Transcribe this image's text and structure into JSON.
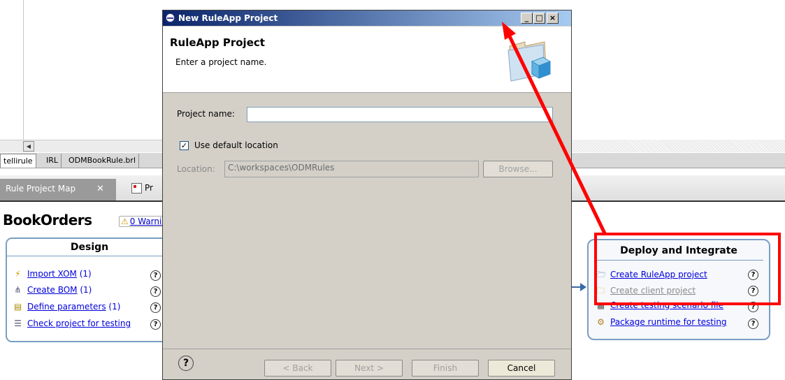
{
  "background": {
    "editor_tabs": [
      "tellirule",
      "IRL",
      "ODMBookRule.brl"
    ],
    "view_tabs": {
      "active": "Rule Project Map",
      "second": "Pr"
    },
    "project_title": "BookOrders",
    "warning_link": "0 Warnin",
    "design": {
      "title": "Design",
      "items": [
        {
          "icon": "lightning-icon",
          "label": "Import XOM",
          "count": "(1)"
        },
        {
          "icon": "bom-icon",
          "label": "Create BOM",
          "count": "(1)"
        },
        {
          "icon": "parameters-icon",
          "label": "Define parameters",
          "count": "(1)"
        },
        {
          "icon": "check-icon",
          "label": "Check project for testing",
          "count": ""
        }
      ]
    },
    "deploy": {
      "title": "Deploy and Integrate",
      "items": [
        {
          "icon": "folder-open-icon",
          "label": "Create RuleApp project",
          "enabled": true
        },
        {
          "icon": "folder-new-icon",
          "label": "Create client project",
          "enabled": false
        },
        {
          "icon": "scenario-file-icon",
          "label": "Create testing scenario file",
          "enabled": true
        },
        {
          "icon": "package-icon",
          "label": "Package runtime for testing",
          "enabled": true
        }
      ]
    }
  },
  "dialog": {
    "window_title": "New RuleApp Project",
    "heading": "RuleApp Project",
    "subtitle": "Enter a project name.",
    "project_name_label": "Project name:",
    "project_name_value": "",
    "use_default_label": "Use default location",
    "use_default_checked": true,
    "location_label": "Location:",
    "location_value": "C:\\workspaces\\ODMRules",
    "browse_label": "Browse...",
    "buttons": {
      "back": "< Back",
      "next": "Next >",
      "finish": "Finish",
      "cancel": "Cancel"
    },
    "help_glyph": "?",
    "window_buttons": {
      "minimize": "_",
      "maximize": "□",
      "close": "×"
    }
  },
  "colors": {
    "annotation": "#ff0000",
    "titlebar_start": "#0a246a",
    "link": "#0000dd"
  }
}
